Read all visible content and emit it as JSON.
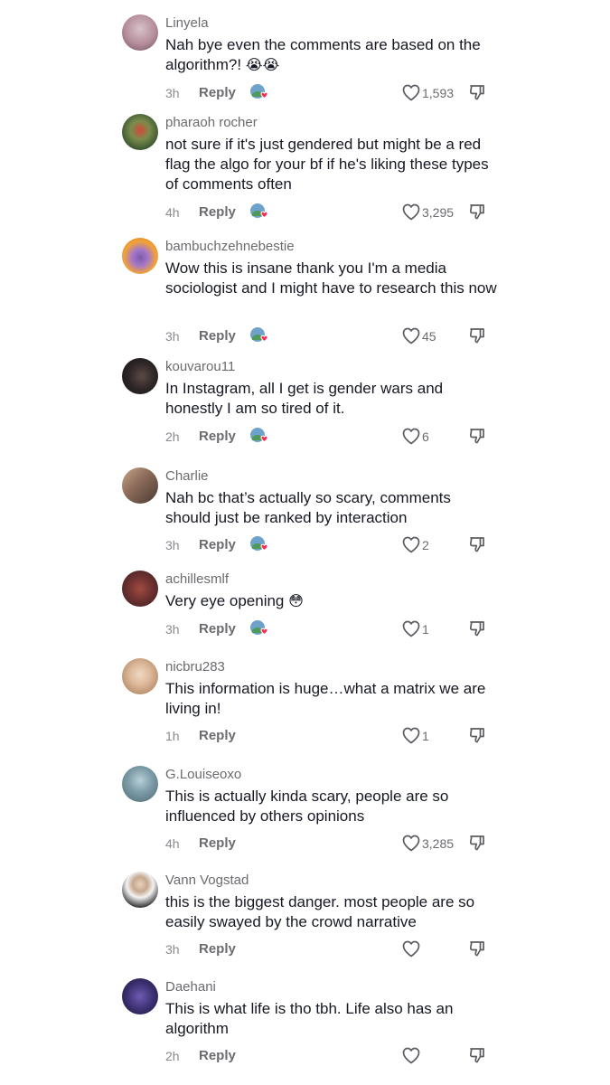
{
  "comments": [
    {
      "username": "Linyela",
      "text": "Nah bye even the comments are based on the algorithm?! 😭😭",
      "time": "3h",
      "reply": "Reply",
      "likes": "1,593",
      "avatar_color": "#c9a9b4"
    },
    {
      "username": "pharaoh rocher",
      "text": "not sure if it's just gendered but might be a red flag the algo for your bf if he's liking these types of comments often",
      "time": "4h",
      "reply": "Reply",
      "likes": "3,295",
      "avatar_color": "#5d7a45"
    },
    {
      "username": "bambuchzehnebestie",
      "text": "Wow this is insane thank you I'm a media sociologist and I might have to research this now",
      "time": "3h",
      "reply": "Reply",
      "likes": "45",
      "avatar_color": "#e8862c"
    },
    {
      "username": "kouvarou11",
      "text": "In Instagram, all I get is gender wars and honestly I am so tired of it.",
      "time": "2h",
      "reply": "Reply",
      "likes": "6",
      "avatar_color": "#2a2222"
    },
    {
      "username": "Charlie",
      "text": "Nah bc that’s actually so scary, comments should just be ranked by interaction",
      "time": "3h",
      "reply": "Reply",
      "likes": "2",
      "avatar_color": "#8a6a58"
    },
    {
      "username": "achillesmlf",
      "text": "Very eye opening 😳",
      "time": "3h",
      "reply": "Reply",
      "likes": "1",
      "avatar_color": "#5a3030"
    },
    {
      "username": "nicbru283",
      "text": "This information is huge…what a matrix we are living in!",
      "time": "1h",
      "reply": "Reply",
      "likes": "1",
      "avatar_color": "#d8b89a"
    },
    {
      "username": "G.Louiseoxo",
      "text": "This is actually kinda scary, people are so influenced by others opinions",
      "time": "4h",
      "reply": "Reply",
      "likes": "3,285",
      "avatar_color": "#6f8f9a"
    },
    {
      "username": "Vann Vogstad",
      "text": "this is the biggest danger. most people are so easily swayed by the crowd narrative",
      "time": "3h",
      "reply": "Reply",
      "likes": "",
      "avatar_color": "#d9d9d9"
    },
    {
      "username": "Daehani",
      "text": "This is what life is tho tbh. Life also has an algorithm",
      "time": "2h",
      "reply": "Reply",
      "likes": "",
      "avatar_color": "#3a2e6e"
    }
  ],
  "colors": {
    "username": "#6b6b70",
    "text": "#161823",
    "meta": "#8a8b91",
    "heart_badge": "#fe2c55"
  },
  "icons": {
    "like": "heart-outline-icon",
    "dislike": "thumbs-down-icon",
    "creator_liked": "creator-liked-icon"
  }
}
